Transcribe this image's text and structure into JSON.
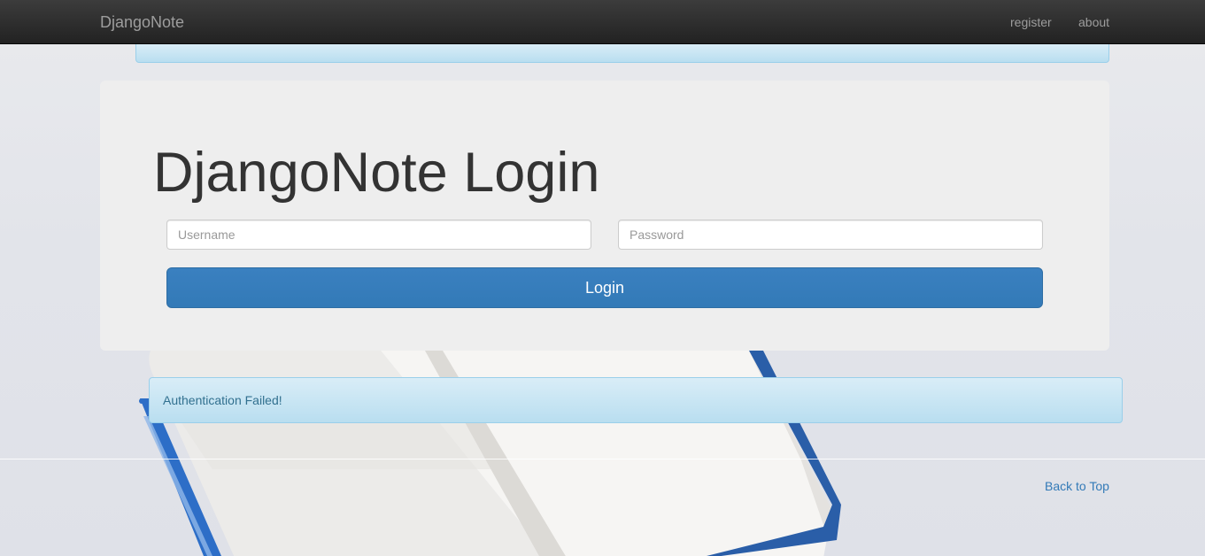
{
  "navbar": {
    "brand": "DjangoNote",
    "links": [
      {
        "label": "register"
      },
      {
        "label": "about"
      }
    ]
  },
  "login": {
    "title": "DjangoNote Login",
    "username_placeholder": "Username",
    "username_value": "",
    "password_placeholder": "Password",
    "password_value": "",
    "button_label": "Login"
  },
  "messages": {
    "error": "Authentication Failed!"
  },
  "footer": {
    "back_to_top": "Back to Top"
  },
  "colors": {
    "navbar": "#222222",
    "primary": "#337ab7",
    "alert_info_bg": "#d9edf7",
    "alert_info_text": "#31708f",
    "jumbotron_bg": "#eeeeee"
  }
}
